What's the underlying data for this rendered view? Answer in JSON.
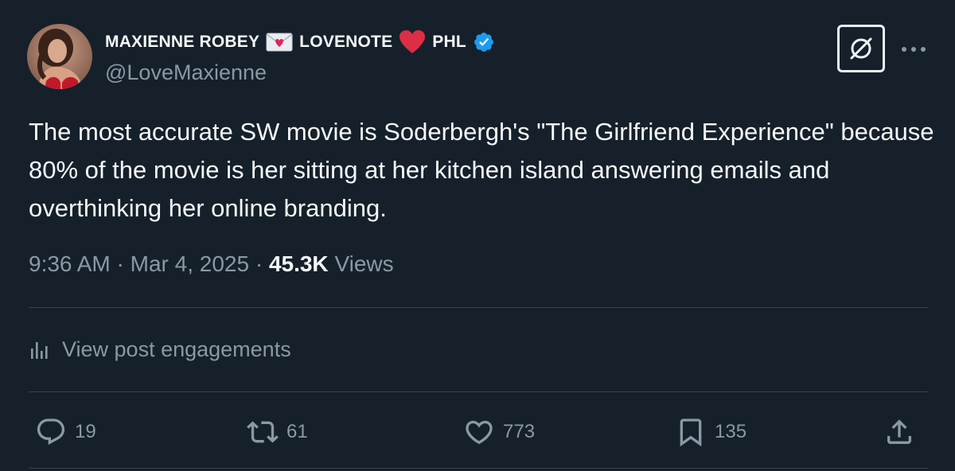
{
  "author": {
    "name_part1": "MAXIENNE ROBEY",
    "name_part2": "LOVENOTE",
    "name_part3": "PHL",
    "handle": "@LoveMaxienne",
    "verified_color": "#1d9bf0",
    "icons": [
      "love-letter-emoji",
      "red-heart-emoji",
      "verified-badge-icon"
    ]
  },
  "post": {
    "text": "The most accurate SW movie is Soderbergh's \"The Girlfriend Experience\" because 80% of the movie is her sitting at her kitchen island answering emails and overthinking her online branding.",
    "time": "9:36 AM",
    "sep1": "·",
    "date": "Mar 4, 2025",
    "sep2": "·",
    "views_count": "45.3K",
    "views_label": "Views"
  },
  "engagements": {
    "label": "View post engagements",
    "icon": "analytics-icon"
  },
  "actions": {
    "replies": "19",
    "reposts": "61",
    "likes": "773",
    "bookmarks": "135",
    "icons": [
      "reply-icon",
      "repost-icon",
      "like-icon",
      "bookmark-icon",
      "share-icon"
    ]
  },
  "colors": {
    "background": "#15202b",
    "text": "#f7f9f9",
    "muted": "#8b98a5",
    "divider": "#38444d",
    "heart": "#e0245e"
  }
}
